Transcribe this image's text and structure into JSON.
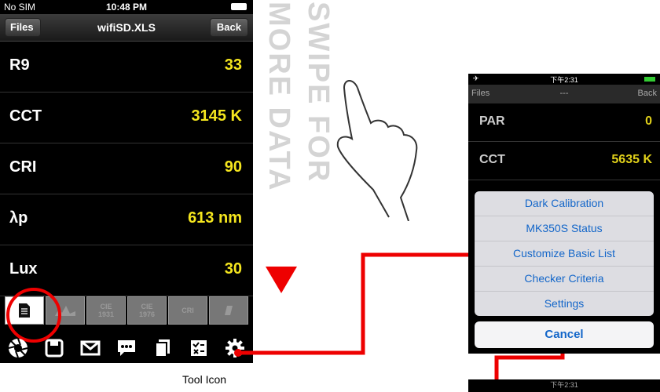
{
  "status": {
    "carrier": "No SIM",
    "time": "10:48 PM"
  },
  "nav": {
    "left": "Files",
    "title": "wifiSD.XLS",
    "right": "Back"
  },
  "rows": [
    {
      "label": "R9",
      "value": "33"
    },
    {
      "label": "CCT",
      "value": "3145 K"
    },
    {
      "label": "CRI",
      "value": "90"
    },
    {
      "label": "λp",
      "value": "613 nm"
    },
    {
      "label": "Lux",
      "value": "30"
    }
  ],
  "tabs": [
    {
      "label": ""
    },
    {
      "label": ""
    },
    {
      "label": "CIE\n1931"
    },
    {
      "label": "CIE\n1976"
    },
    {
      "label": "CRI"
    },
    {
      "label": ""
    }
  ],
  "tools": [
    "aperture-icon",
    "save-icon",
    "mail-icon",
    "chat-icon",
    "copy-icon",
    "checklist-icon",
    "gear-icon"
  ],
  "swipe": {
    "line1": "SWIPE FOR",
    "line2": "MORE DATA"
  },
  "tool_label": "Tool Icon",
  "phone2": {
    "time": "下午2:31",
    "nav_left": "Files",
    "nav_title": "---",
    "nav_right": "Back",
    "rows": [
      {
        "label": "PAR",
        "value": "0"
      },
      {
        "label": "CCT",
        "value": "5635 K"
      }
    ],
    "menu": [
      "Dark Calibration",
      "MK350S Status",
      "Customize Basic List",
      "Checker Criteria",
      "Settings"
    ],
    "cancel": "Cancel"
  },
  "phone3": {
    "time": "下午2:31"
  },
  "colors": {
    "accent": "#e00000",
    "value": "#f5e61e",
    "menu": "#1366c9"
  }
}
